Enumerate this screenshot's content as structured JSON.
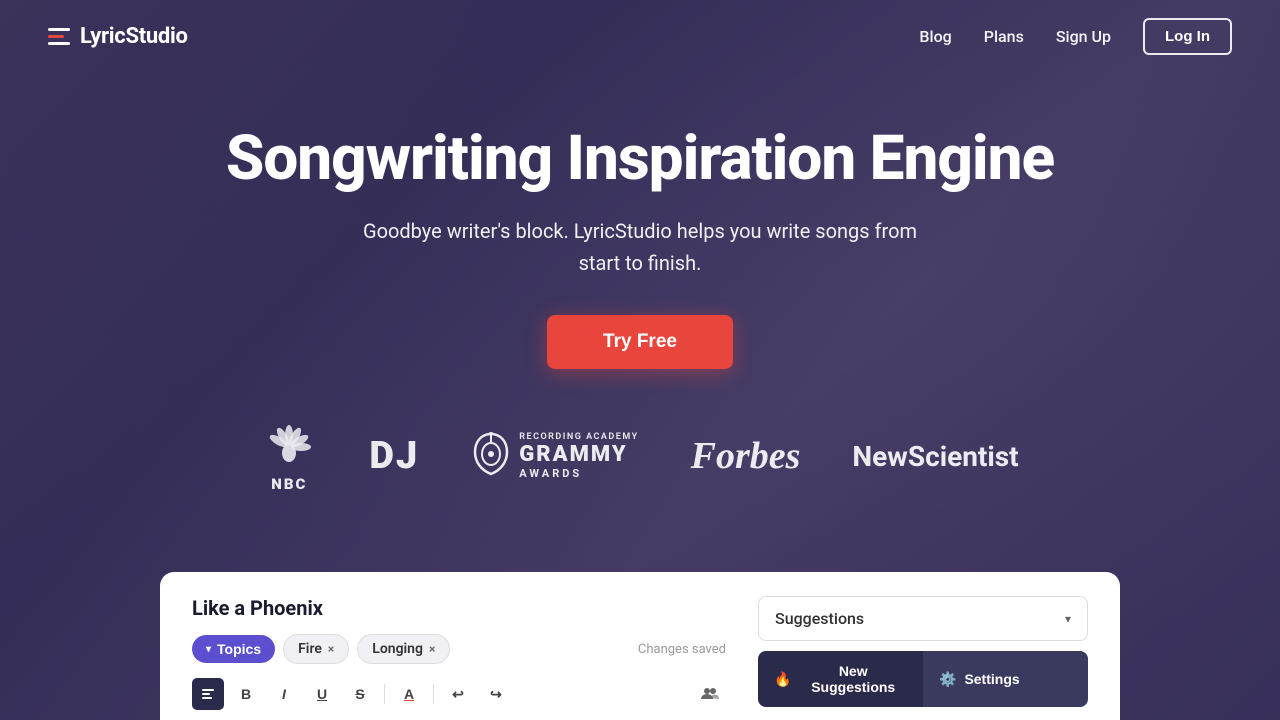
{
  "brand": {
    "name": "LyricStudio"
  },
  "navbar": {
    "blog_label": "Blog",
    "plans_label": "Plans",
    "signup_label": "Sign Up",
    "login_label": "Log In"
  },
  "hero": {
    "title": "Songwriting Inspiration Engine",
    "subtitle": "Goodbye writer's block. LyricStudio helps you write songs from start to finish.",
    "cta_label": "Try Free"
  },
  "logos": [
    {
      "id": "nbc",
      "name": "NBC"
    },
    {
      "id": "dj",
      "name": "DJ"
    },
    {
      "id": "grammy",
      "name": "GRAMMY AWARDS"
    },
    {
      "id": "forbes",
      "name": "Forbes"
    },
    {
      "id": "newscientist",
      "name": "NewScientist"
    }
  ],
  "editor": {
    "song_title": "Like a Phoenix",
    "topics_label": "Topics",
    "tags": [
      "Fire",
      "Longing"
    ],
    "changes_saved": "Changes saved",
    "suggestions_placeholder": "Suggestions",
    "new_suggestions_label": "New Suggestions",
    "settings_label": "Settings",
    "toolbar": {
      "bold": "B",
      "italic": "I",
      "underline": "U",
      "strikethrough": "S",
      "color": "A",
      "undo": "↩",
      "redo": "↪"
    }
  },
  "colors": {
    "cta_bg": "#e8453c",
    "logo_text": "white",
    "nav_login_border": "rgba(255,255,255,0.9)",
    "topics_tag_bg": "#5b4fcf",
    "dark_panel_bg": "#2a2a4a"
  }
}
